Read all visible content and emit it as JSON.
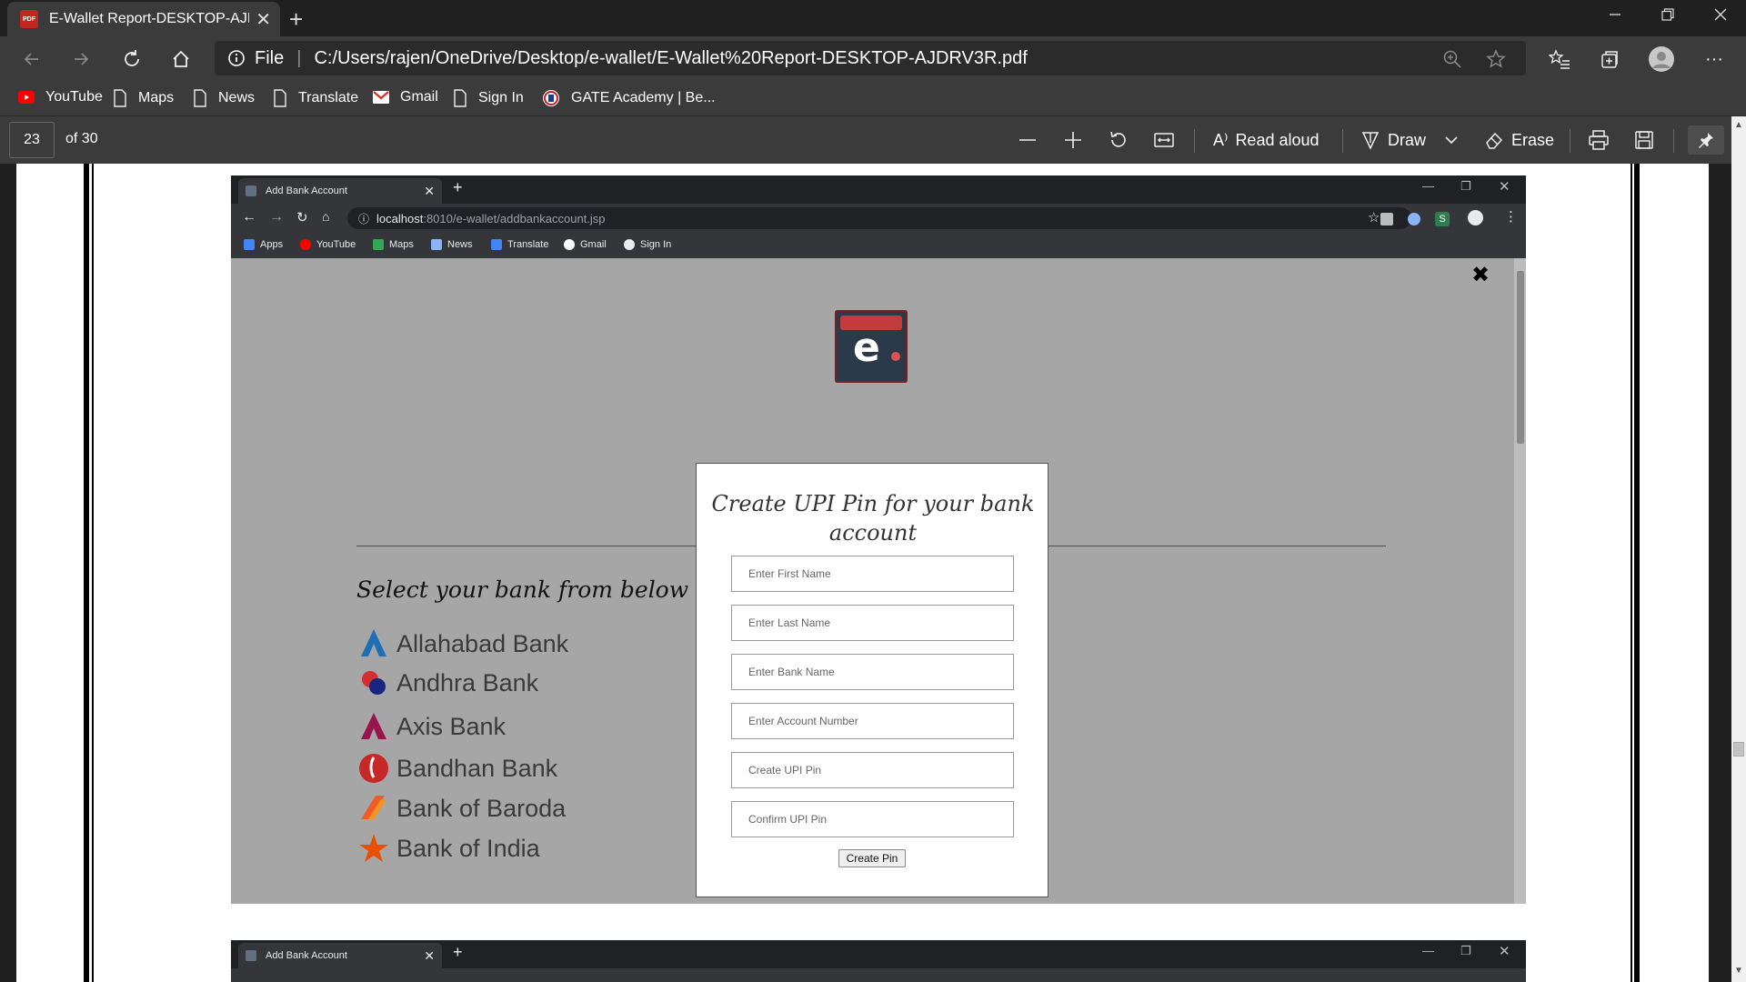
{
  "browser": {
    "tab_title": "E-Wallet Report-DESKTOP-AJDRV3R.pdf",
    "tab_icon_text": "PDF",
    "address_scheme": "File",
    "address_url": "C:/Users/rajen/OneDrive/Desktop/e-wallet/E-Wallet%20Report-DESKTOP-AJDRV3R.pdf",
    "bookmarks": [
      {
        "label": "YouTube",
        "icon": "youtube-icon"
      },
      {
        "label": "Maps",
        "icon": "page-icon"
      },
      {
        "label": "News",
        "icon": "page-icon"
      },
      {
        "label": "Translate",
        "icon": "page-icon"
      },
      {
        "label": "Gmail",
        "icon": "gmail-icon"
      },
      {
        "label": "Sign In",
        "icon": "page-icon"
      },
      {
        "label": "GATE Academy | Be...",
        "icon": "gate-icon"
      }
    ]
  },
  "pdf_toolbar": {
    "current_page": "23",
    "page_count": "of 30",
    "read_aloud": "Read aloud",
    "draw": "Draw",
    "erase": "Erase"
  },
  "inner_browser": {
    "tab_title": "Add Bank Account",
    "url_host": "localhost",
    "url_rest": ":8010/e-wallet/addbankaccount.jsp",
    "bookmarks": [
      "Apps",
      "YouTube",
      "Maps",
      "News",
      "Translate",
      "Gmail",
      "Sign In"
    ]
  },
  "page": {
    "select_heading": "Select your bank from below",
    "banks": [
      "Allahabad Bank",
      "Andhra Bank",
      "Axis Bank",
      "Bandhan Bank",
      "Bank of Baroda",
      "Bank of India"
    ],
    "close_symbol": "✖"
  },
  "modal": {
    "title": "Create UPI Pin for your bank account",
    "fields": [
      {
        "placeholder": "Enter First Name",
        "value": ""
      },
      {
        "placeholder": "Enter Last Name",
        "value": ""
      },
      {
        "placeholder": "Enter Bank Name",
        "value": ""
      },
      {
        "placeholder": "Enter Account Number",
        "value": ""
      },
      {
        "placeholder": "Create UPI Pin",
        "value": ""
      },
      {
        "placeholder": "Confirm UPI Pin",
        "value": ""
      }
    ],
    "button": "Create Pin"
  },
  "colors": {
    "edge_dark": "#3b3b3b",
    "chrome_dark": "#35363a",
    "page_bg": "#a6a6a6",
    "logo_red": "#c43b3b",
    "logo_navy": "#2b3a4a"
  }
}
